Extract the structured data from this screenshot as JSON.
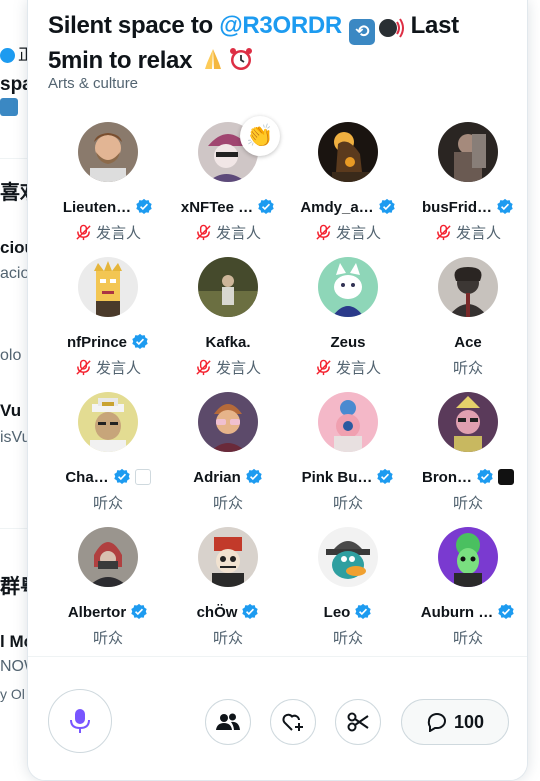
{
  "background": {
    "fragments": [
      "正",
      "spa",
      "喜欢",
      "ciou",
      "acio",
      "olo",
      "Vu",
      "isVu",
      "群粤",
      "l Mc",
      "NOW",
      "y Ol"
    ]
  },
  "space": {
    "title_handle": "@R3ORDR",
    "title_prefix": "Silent space to ",
    "title_mid": " Last",
    "title_line2": "5min to relax",
    "category": "Arts & culture"
  },
  "participants": [
    {
      "name": "Lieuten…",
      "role": "发言人",
      "muted": true,
      "verified": true
    },
    {
      "name": "xNFTee …",
      "role": "发言人",
      "muted": true,
      "verified": true,
      "reaction": "👏"
    },
    {
      "name": "Amdy_a…",
      "role": "发言人",
      "muted": true,
      "verified": true
    },
    {
      "name": "busFrid…",
      "role": "发言人",
      "muted": true,
      "verified": true
    },
    {
      "name": "nfPrince",
      "role": "发言人",
      "muted": true,
      "verified": true
    },
    {
      "name": "Kafka.",
      "role": "发言人",
      "muted": true,
      "verified": false
    },
    {
      "name": "Zeus",
      "role": "发言人",
      "muted": true,
      "verified": false
    },
    {
      "name": "Ace",
      "role": "听众",
      "muted": false,
      "verified": false
    },
    {
      "name": "Cha…",
      "role": "听众",
      "muted": false,
      "verified": true
    },
    {
      "name": "Adrian",
      "role": "听众",
      "muted": false,
      "verified": true
    },
    {
      "name": "Pink Bu…",
      "role": "听众",
      "muted": false,
      "verified": true
    },
    {
      "name": "Bron…",
      "role": "听众",
      "muted": false,
      "verified": true
    },
    {
      "name": "Albertor",
      "role": "听众",
      "muted": false,
      "verified": true
    },
    {
      "name": "chÖw",
      "role": "听众",
      "muted": false,
      "verified": true
    },
    {
      "name": "Leo",
      "role": "听众",
      "muted": false,
      "verified": true
    },
    {
      "name": "Auburn …",
      "role": "听众",
      "muted": false,
      "verified": true
    }
  ],
  "controls": {
    "comment_count": "100",
    "icons": [
      "mic-icon",
      "people-icon",
      "heart-plus-icon",
      "scissors-icon",
      "comment-icon"
    ]
  },
  "colors": {
    "accent": "#1d9bf0",
    "muted_red": "#f4212e",
    "mic_purple": "#7856ff",
    "text_secondary": "#536471"
  }
}
